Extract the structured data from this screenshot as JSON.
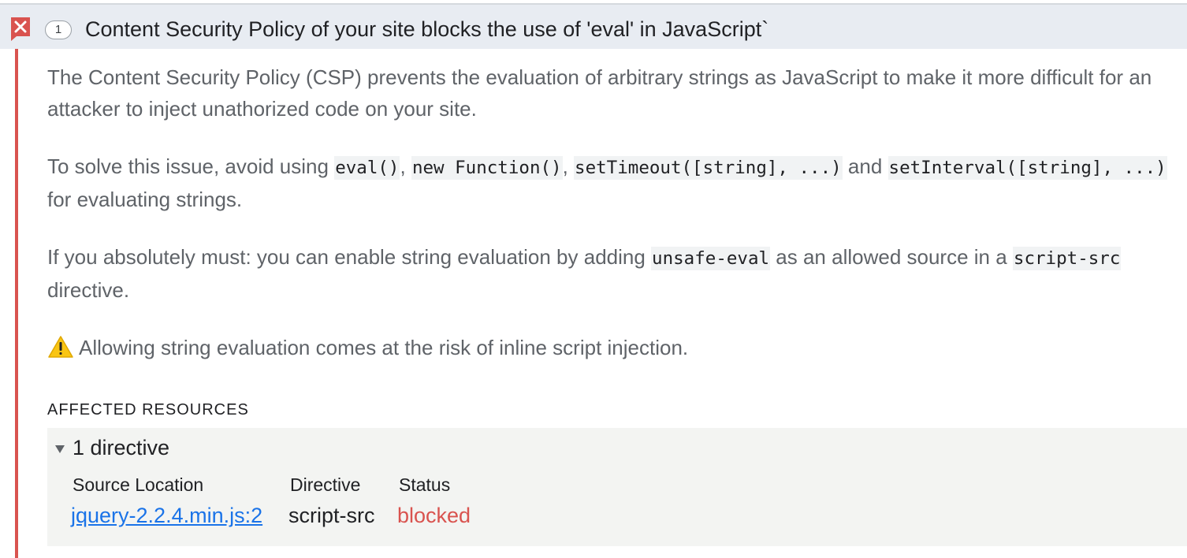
{
  "issue": {
    "count": "1",
    "title": "Content Security Policy of your site blocks the use of 'eval' in JavaScript`",
    "severity_color": "#d9534f"
  },
  "description": {
    "p1": "The Content Security Policy (CSP) prevents the evaluation of arbitrary strings as JavaScript to make it more difficult for an attacker to inject unathorized code on your site.",
    "p2": {
      "t1": "To solve this issue, avoid using ",
      "c1": "eval()",
      "t2": ", ",
      "c2": "new Function()",
      "t3": ", ",
      "c3": "setTimeout([string], ...)",
      "t4": " and ",
      "c4": "setInterval([string], ...)",
      "t5": " for evaluating strings."
    },
    "p3": {
      "t1": "If you absolutely must: you can enable string evaluation by adding ",
      "c1": "unsafe-eval",
      "t2": " as an allowed source in a ",
      "c2": "script-src",
      "t3": " directive."
    },
    "warning": "Allowing string evaluation comes at the risk of inline script injection."
  },
  "affected_resources": {
    "label": "AFFECTED RESOURCES",
    "toggle_label": "1 directive",
    "columns": [
      "Source Location",
      "Directive",
      "Status"
    ],
    "rows": [
      {
        "source": "jquery-2.2.4.min.js:2",
        "directive": "script-src",
        "status": "blocked"
      }
    ]
  },
  "icons": {
    "error": "error-x-icon",
    "warning": "warning-triangle-icon",
    "toggle": "triangle-down-icon"
  }
}
